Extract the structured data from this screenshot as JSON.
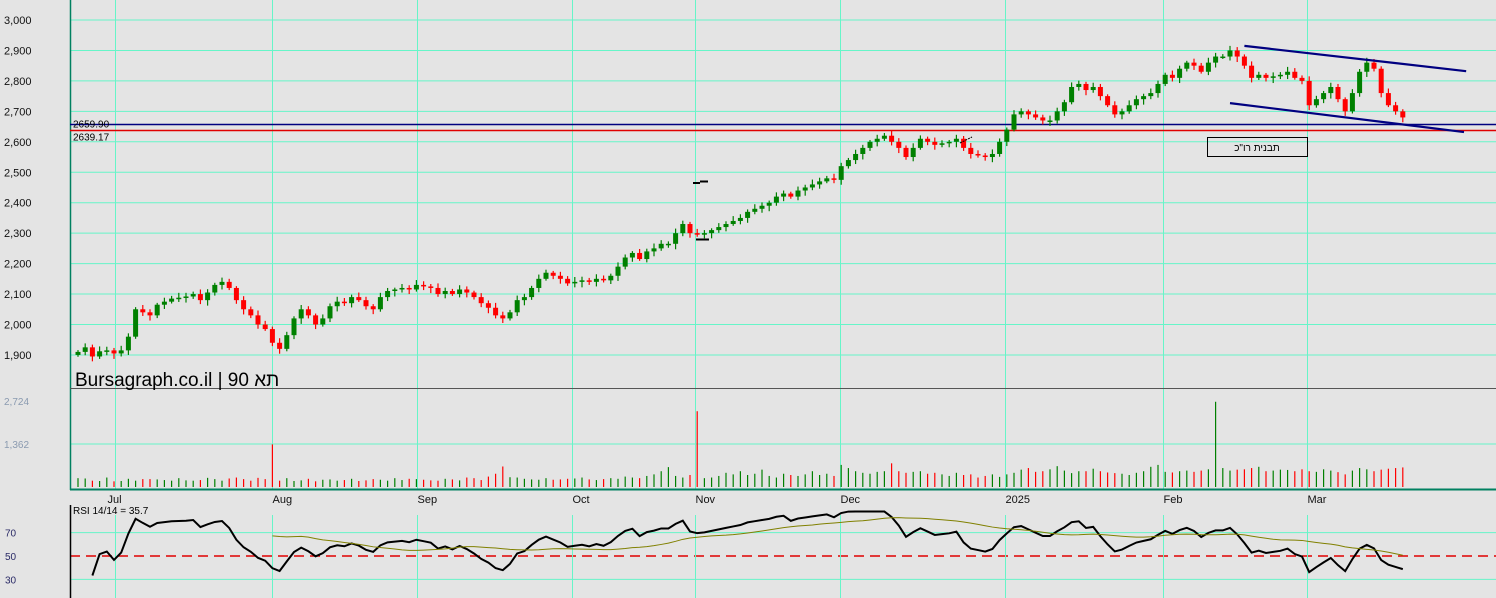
{
  "chart_data": {
    "type": "candlestick",
    "title": "Bursagraph.co.il | תא 90",
    "price_axis": {
      "ylim": [
        1850,
        3050
      ],
      "ticks": [
        "3,000",
        "2,900",
        "2,800",
        "2,700",
        "2,600",
        "2,500",
        "2,400",
        "2,300",
        "2,200",
        "2,100",
        "2,000",
        "1,900"
      ],
      "tick_values": [
        3000,
        2900,
        2800,
        2700,
        2600,
        2500,
        2400,
        2300,
        2200,
        2100,
        2000,
        1900
      ]
    },
    "months": [
      {
        "label": "Jul",
        "bar": 5.1
      },
      {
        "label": "Aug",
        "bar": 27
      },
      {
        "label": "Sep",
        "bar": 47.1
      },
      {
        "label": "Oct",
        "bar": 68.6
      },
      {
        "label": "Nov",
        "bar": 85.7
      },
      {
        "label": "Dec",
        "bar": 105.8
      },
      {
        "label": "2025",
        "bar": 128.8
      },
      {
        "label": "Feb",
        "bar": 150.7
      },
      {
        "label": "Mar",
        "bar": 170.7
      }
    ],
    "closes": [
      1910,
      1925,
      1895,
      1912,
      1915,
      1905,
      1915,
      1960,
      2050,
      2040,
      2030,
      2065,
      2075,
      2085,
      2088,
      2092,
      2100,
      2080,
      2105,
      2130,
      2140,
      2120,
      2080,
      2050,
      2030,
      2000,
      1985,
      1940,
      1920,
      1965,
      2020,
      2050,
      2030,
      2000,
      2020,
      2060,
      2075,
      2070,
      2090,
      2080,
      2060,
      2050,
      2090,
      2110,
      2115,
      2120,
      2115,
      2130,
      2125,
      2120,
      2100,
      2110,
      2100,
      2115,
      2105,
      2090,
      2070,
      2055,
      2030,
      2020,
      2040,
      2080,
      2090,
      2120,
      2150,
      2170,
      2160,
      2150,
      2135,
      2140,
      2145,
      2140,
      2150,
      2145,
      2160,
      2190,
      2220,
      2235,
      2215,
      2240,
      2250,
      2265,
      2265,
      2300,
      2330,
      2300,
      2295,
      2300,
      2310,
      2320,
      2330,
      2340,
      2350,
      2370,
      2380,
      2390,
      2400,
      2420,
      2430,
      2420,
      2440,
      2450,
      2460,
      2470,
      2480,
      2475,
      2520,
      2540,
      2560,
      2580,
      2600,
      2610,
      2620,
      2600,
      2580,
      2550,
      2580,
      2610,
      2600,
      2590,
      2595,
      2600,
      2610,
      2580,
      2560,
      2555,
      2550,
      2560,
      2600,
      2640,
      2690,
      2700,
      2690,
      2680,
      2670,
      2670,
      2700,
      2730,
      2780,
      2790,
      2770,
      2780,
      2750,
      2720,
      2690,
      2700,
      2720,
      2740,
      2750,
      2760,
      2790,
      2820,
      2810,
      2840,
      2860,
      2850,
      2830,
      2860,
      2880,
      2880,
      2900,
      2880,
      2850,
      2810,
      2820,
      2810,
      2815,
      2820,
      2830,
      2810,
      2800,
      2720,
      2740,
      2760,
      2780,
      2740,
      2700,
      2760,
      2830,
      2860,
      2840,
      2760,
      2720,
      2700,
      2680
    ],
    "horizontal_lines": [
      {
        "label": "2659.90",
        "value": 2659.9,
        "color": "#000080"
      },
      {
        "label": "2639.17",
        "value": 2639.17,
        "color": "#e00000"
      }
    ],
    "channel": {
      "color": "#000080",
      "upper": [
        {
          "bar": 162,
          "price": 2915
        },
        {
          "bar": 192.8,
          "price": 2832
        }
      ],
      "lower": [
        {
          "bar": 160,
          "price": 2727
        },
        {
          "bar": 192.5,
          "price": 2632
        }
      ]
    },
    "pattern_label": "תבנית רו\"כ",
    "volume": {
      "ticks": [
        "2,724",
        "1,362"
      ],
      "tick_values": [
        2724,
        1362
      ],
      "ylim": [
        0,
        3000
      ],
      "values": [
        280,
        270,
        200,
        190,
        300,
        180,
        190,
        260,
        200,
        250,
        250,
        240,
        220,
        200,
        280,
        210,
        200,
        220,
        290,
        250,
        200,
        270,
        300,
        250,
        200,
        290,
        250,
        1350,
        200,
        280,
        190,
        210,
        260,
        180,
        230,
        240,
        200,
        220,
        260,
        190,
        210,
        250,
        230,
        200,
        280,
        220,
        260,
        250,
        230,
        210,
        200,
        260,
        240,
        210,
        300,
        280,
        220,
        330,
        420,
        650,
        310,
        300,
        260,
        240,
        230,
        280,
        230,
        240,
        260,
        270,
        300,
        240,
        220,
        250,
        280,
        260,
        330,
        300,
        280,
        350,
        400,
        500,
        630,
        350,
        300,
        380,
        2400,
        280,
        300,
        350,
        450,
        400,
        500,
        380,
        420,
        550,
        350,
        300,
        420,
        380,
        350,
        400,
        500,
        380,
        420,
        350,
        700,
        600,
        500,
        450,
        420,
        480,
        500,
        750,
        500,
        450,
        480,
        500,
        420,
        450,
        400,
        350,
        450,
        380,
        400,
        300,
        350,
        400,
        320,
        400,
        450,
        550,
        600,
        480,
        500,
        560,
        660,
        520,
        440,
        500,
        500,
        580,
        500,
        460,
        440,
        420,
        380,
        450,
        500,
        640,
        700,
        480,
        460,
        500,
        520,
        480,
        520,
        560,
        2700,
        600,
        520,
        550,
        560,
        600,
        640,
        500,
        520,
        550,
        540,
        500,
        560,
        500,
        480,
        560,
        520,
        470,
        400,
        520,
        600,
        560,
        500,
        550,
        580,
        600,
        620
      ]
    },
    "rsi": {
      "label": "RSI 14/14 = 35.7",
      "period": 14,
      "ticks": [
        "70",
        "50",
        "30"
      ],
      "tick_values": [
        70,
        50,
        30
      ],
      "ylim": [
        20,
        90
      ]
    },
    "colors": {
      "up": "#008000",
      "down": "#ff0000",
      "grid": "#66f5c8",
      "background": "#e4e4e4",
      "rsi_line": "#000000",
      "rsi_signal": "#808000"
    }
  }
}
